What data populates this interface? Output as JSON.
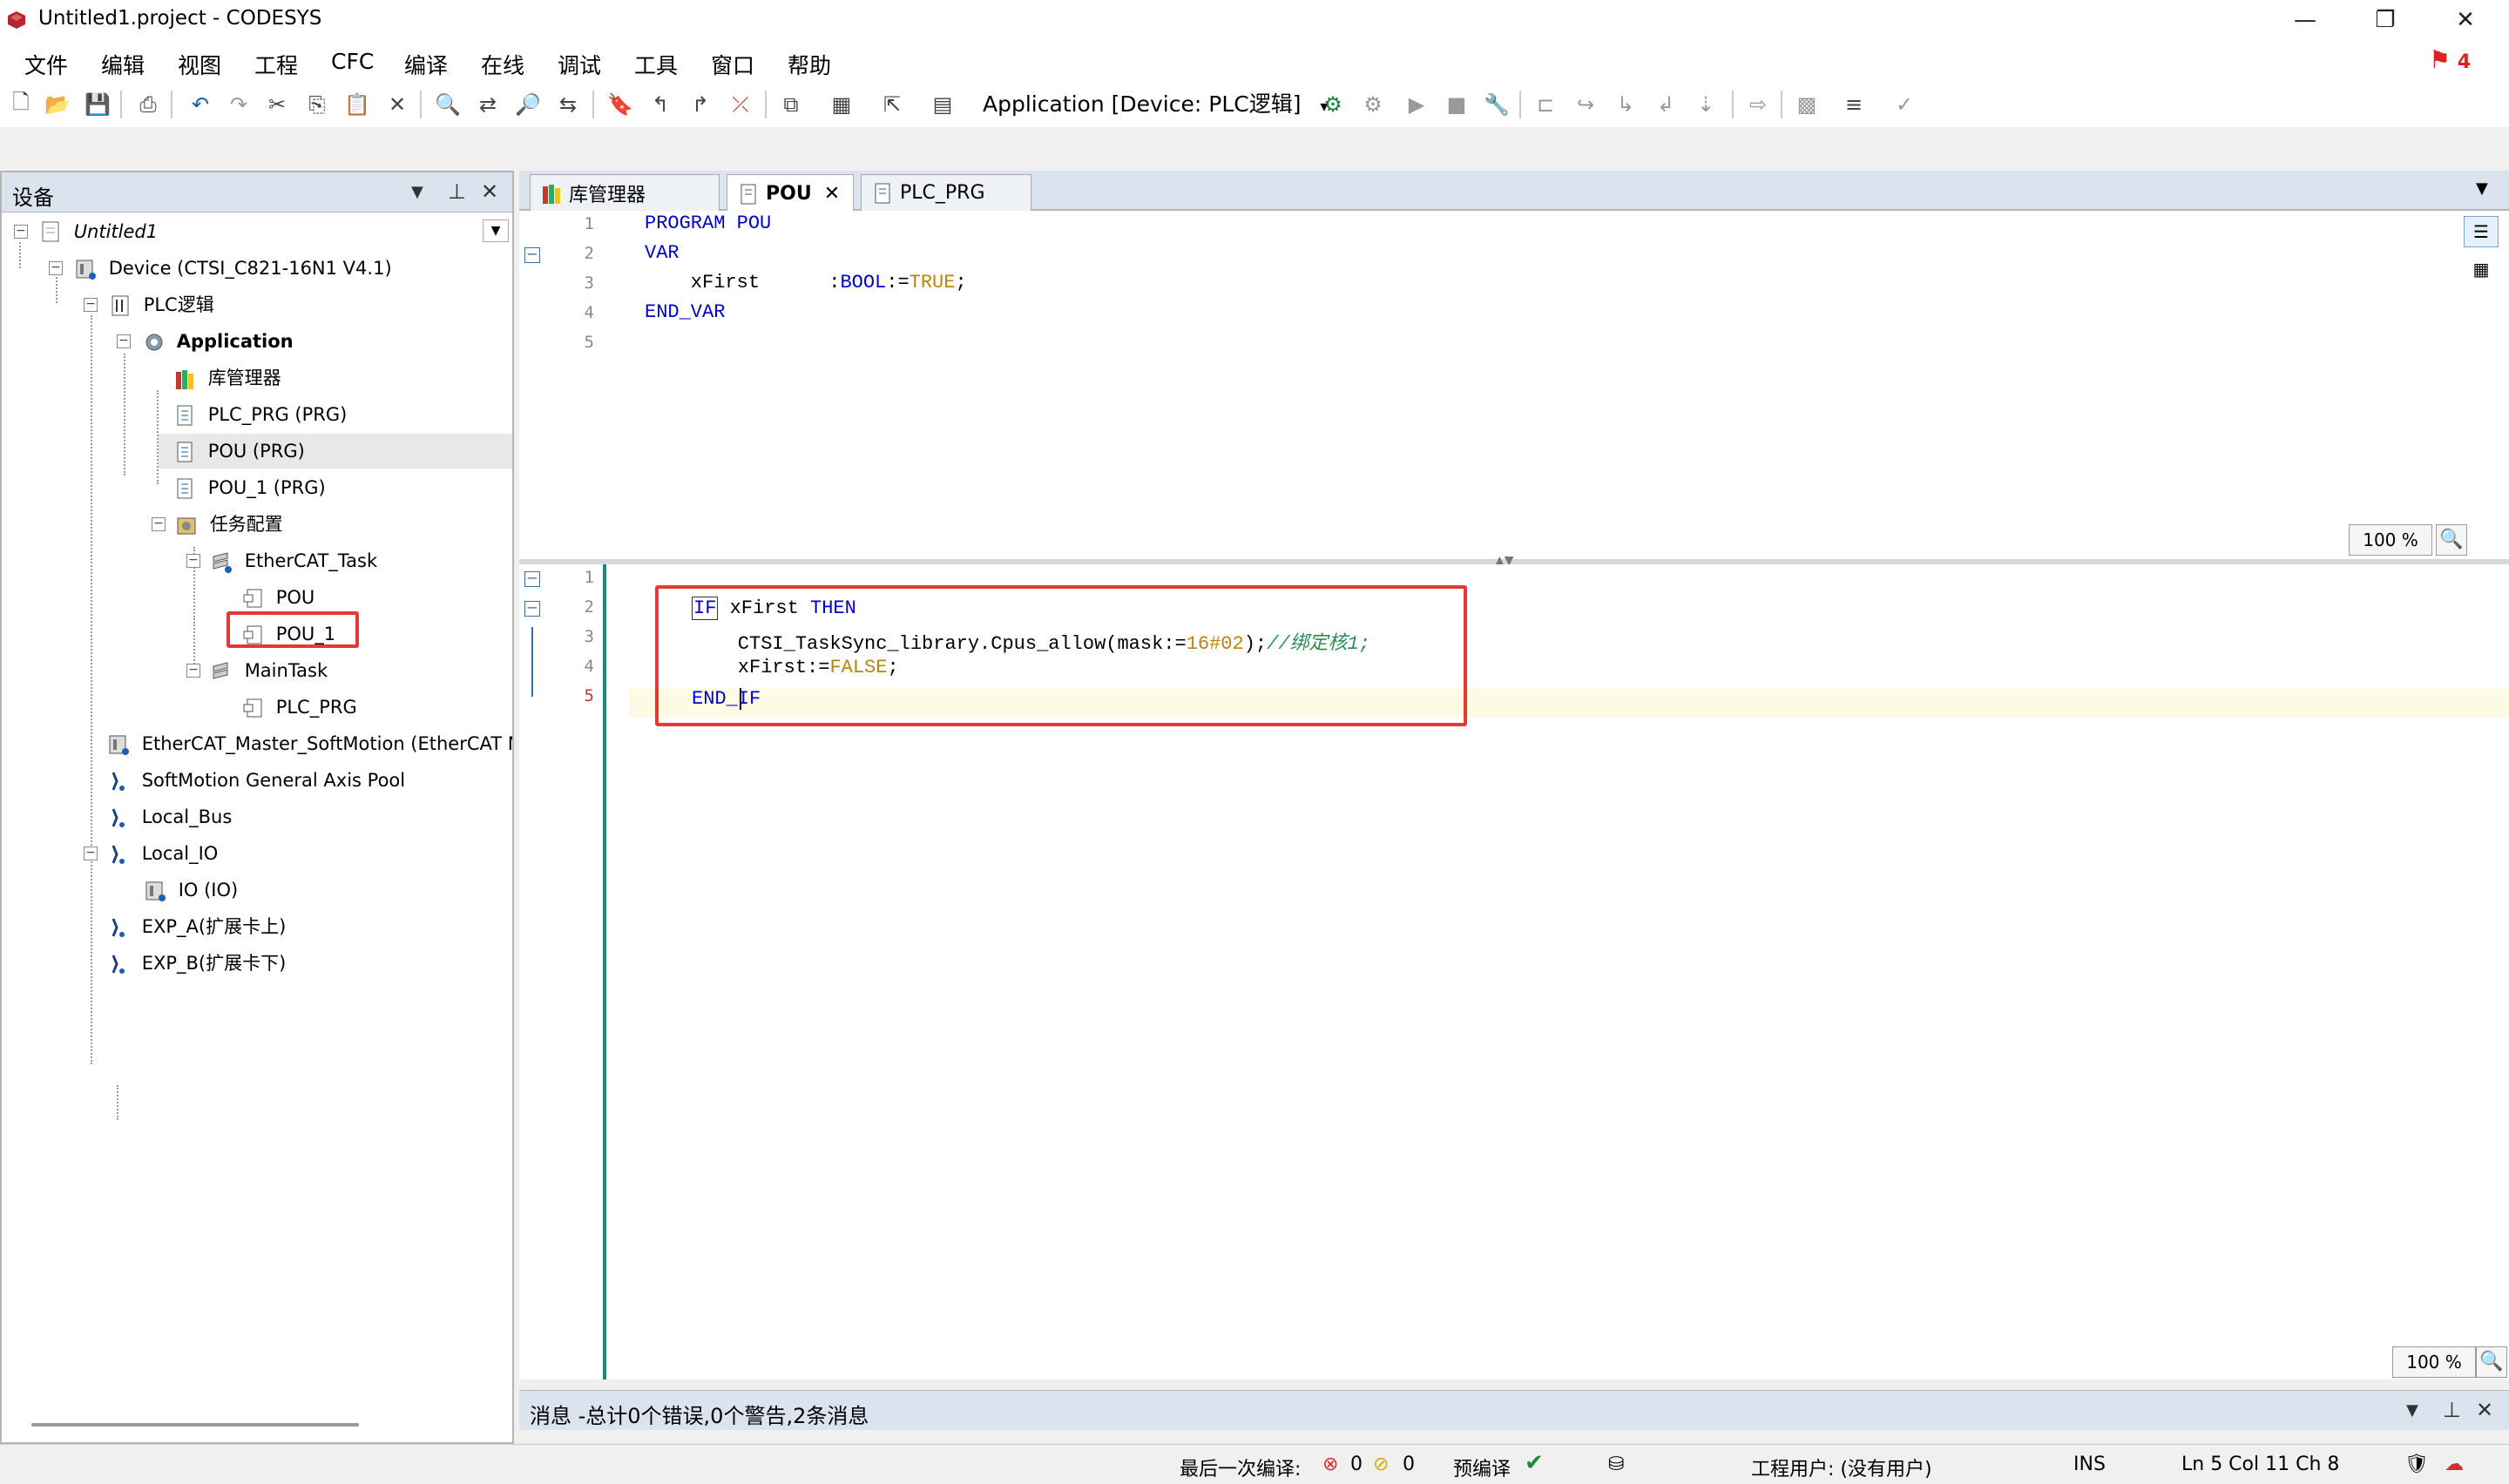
{
  "window": {
    "title": "Untitled1.project - CODESYS",
    "minimize": "—",
    "restore": "❐",
    "close": "✕"
  },
  "menu": [
    "文件",
    "编辑",
    "视图",
    "工程",
    "CFC",
    "编译",
    "在线",
    "调试",
    "工具",
    "窗口",
    "帮助"
  ],
  "alert_count": "4",
  "toolbar": {
    "app_selector": "Application [Device: PLC逻辑]",
    "dropdown_icon": "▾"
  },
  "devices_panel": {
    "title": "设备",
    "tree": [
      {
        "label": "Untitled1",
        "italic": true
      },
      {
        "label": "Device (CTSI_C821-16N1 V4.1)"
      },
      {
        "label": "PLC逻辑"
      },
      {
        "label": "Application",
        "bold": true
      },
      {
        "label": "库管理器"
      },
      {
        "label": "PLC_PRG (PRG)"
      },
      {
        "label": "POU (PRG)",
        "selected": true
      },
      {
        "label": "POU_1 (PRG)"
      },
      {
        "label": "任务配置"
      },
      {
        "label": "EtherCAT_Task"
      },
      {
        "label": "POU"
      },
      {
        "label": "POU_1"
      },
      {
        "label": "MainTask"
      },
      {
        "label": "PLC_PRG"
      },
      {
        "label": "EtherCAT_Master_SoftMotion (EtherCAT M"
      },
      {
        "label": "SoftMotion General Axis Pool"
      },
      {
        "label": "Local_Bus"
      },
      {
        "label": "Local_IO"
      },
      {
        "label": "IO (IO)"
      },
      {
        "label": "EXP_A(扩展卡上)"
      },
      {
        "label": "EXP_B(扩展卡下)"
      }
    ]
  },
  "tabs": [
    {
      "label": "库管理器"
    },
    {
      "label": "POU",
      "active": true,
      "close": "✕"
    },
    {
      "label": "PLC_PRG"
    }
  ],
  "declaration": {
    "line_numbers": [
      "1",
      "2",
      "3",
      "4",
      "5"
    ],
    "lines": {
      "l1_kw": "PROGRAM",
      "l1_name": " POU",
      "l2_kw": "VAR",
      "l3_var": "    xFirst      :",
      "l3_type": "BOOL",
      "l3_assign": ":=",
      "l3_val": "TRUE",
      "l3_end": ";",
      "l4_kw": "END_VAR"
    },
    "zoom": "100 %"
  },
  "implementation": {
    "line_numbers": [
      "1",
      "2",
      "3",
      "4",
      "5"
    ],
    "lines": {
      "l1_kw": "IF",
      "l1_var": " xFirst ",
      "l1_then": "THEN",
      "l2_call": "    CTSI_TaskSync_library.Cpus_allow(mask:=",
      "l2_lit": "16#02",
      "l2_end": ");",
      "l2_cmt": "//绑定核1;",
      "l3_var": "    xFirst:=",
      "l3_lit": "FALSE",
      "l3_end": ";",
      "l4_kw": "END_IF"
    },
    "zoom": "100 %"
  },
  "messages": {
    "title": "消息 -总计0个错误,0个警告,2条消息"
  },
  "status": {
    "last_build_label": "最后一次编译:",
    "errors": "0",
    "warnings": "0",
    "precompile": "预编译",
    "project_user": "工程用户: (没有用户)",
    "mode": "INS",
    "position": "Ln 5  Col 11  Ch 8"
  }
}
